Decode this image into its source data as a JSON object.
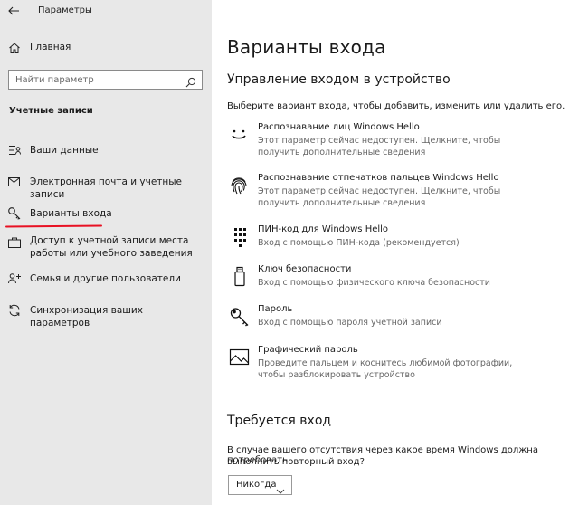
{
  "window": {
    "title": "Параметры"
  },
  "sidebar": {
    "home_label": "Главная",
    "search_placeholder": "Найти параметр",
    "section_title": "Учетные записи",
    "items": [
      {
        "label": "Ваши данные",
        "icon": "person-card-icon"
      },
      {
        "label": "Электронная почта и учетные записи",
        "icon": "mail-icon"
      },
      {
        "label": "Варианты входа",
        "icon": "key-icon",
        "selected": true
      },
      {
        "label": "Доступ к учетной записи места работы или учебного заведения",
        "icon": "briefcase-icon"
      },
      {
        "label": "Семья и другие пользователи",
        "icon": "people-icon"
      },
      {
        "label": "Синхронизация ваших параметров",
        "icon": "sync-icon"
      }
    ]
  },
  "main": {
    "page_title": "Варианты входа",
    "manage_heading": "Управление входом в устройство",
    "manage_desc": "Выберите вариант входа, чтобы добавить, изменить или удалить его.",
    "options": [
      {
        "title": "Распознавание лиц Windows Hello",
        "desc": "Этот параметр сейчас недоступен. Щелкните, чтобы получить дополнительные сведения",
        "icon": "face-icon"
      },
      {
        "title": "Распознавание отпечатков пальцев Windows Hello",
        "desc": "Этот параметр сейчас недоступен. Щелкните, чтобы получить дополнительные сведения",
        "icon": "fingerprint-icon"
      },
      {
        "title": "ПИН-код для Windows Hello",
        "desc": "Вход с помощью ПИН-кода (рекомендуется)",
        "icon": "keypad-icon"
      },
      {
        "title": "Ключ безопасности",
        "desc": "Вход с помощью физического ключа безопасности",
        "icon": "usb-key-icon"
      },
      {
        "title": "Пароль",
        "desc": "Вход с помощью пароля учетной записи",
        "icon": "key-icon"
      },
      {
        "title": "Графический пароль",
        "desc": "Проведите пальцем и коснитесь любимой фотографии, чтобы разблокировать устройство",
        "icon": "picture-icon"
      }
    ],
    "require_heading": "Требуется вход",
    "require_desc_line1": "В случае вашего отсутствия через какое время Windows должна потребовать",
    "require_desc_line2": "выполнить повторный вход?",
    "require_value": "Никогда"
  },
  "colors": {
    "sidebar_bg": "#e8e8e8",
    "underline": "#e81123",
    "muted_text": "#666666"
  }
}
